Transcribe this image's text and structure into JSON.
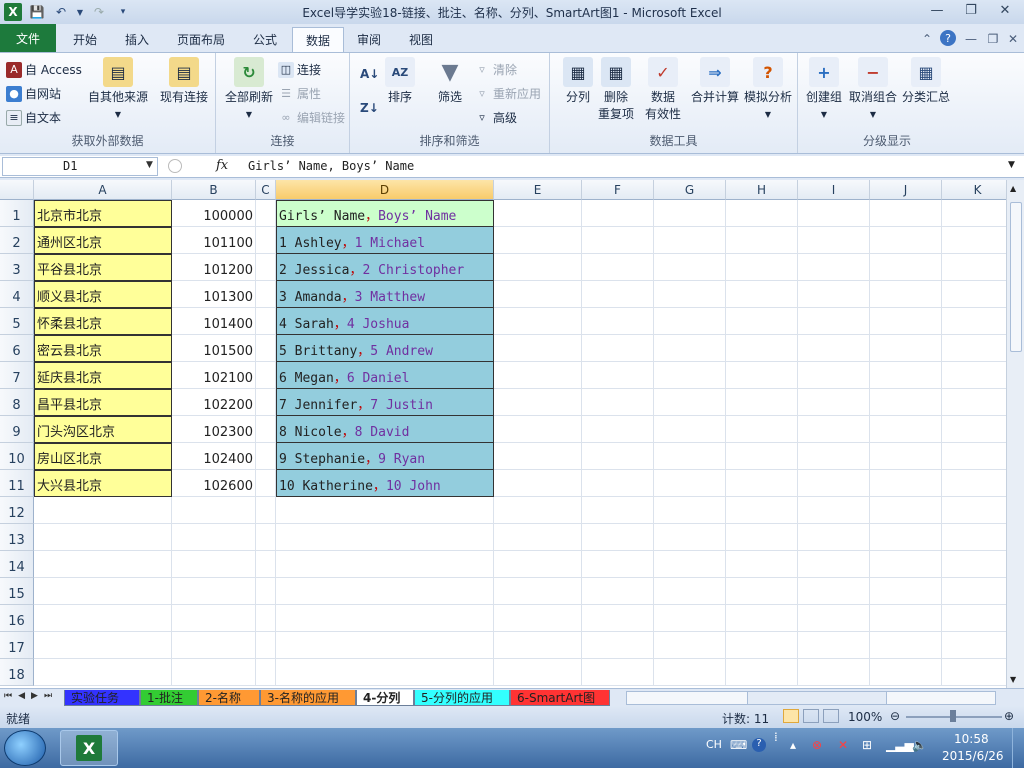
{
  "window": {
    "title": "Excel导学实验18-链接、批注、名称、分列、SmartArt图1 - Microsoft Excel"
  },
  "ribbon_tabs": [
    "文件",
    "开始",
    "插入",
    "页面布局",
    "公式",
    "数据",
    "审阅",
    "视图"
  ],
  "active_tab": "数据",
  "ribbon": {
    "get_external": {
      "label": "获取外部数据",
      "access": "自 Access",
      "web": "自网站",
      "text": "自文本",
      "other": "自其他来源",
      "existing": "现有连接"
    },
    "connections": {
      "label": "连接",
      "refresh_all": "全部刷新",
      "connections": "连接",
      "properties": "属性",
      "edit_links": "编辑链接"
    },
    "sort_filter": {
      "label": "排序和筛选",
      "sort": "排序",
      "filter": "筛选",
      "clear": "清除",
      "reapply": "重新应用",
      "advanced": "高级"
    },
    "data_tools": {
      "label": "数据工具",
      "text_to_columns": "分列",
      "remove_dup_1": "删除",
      "remove_dup_2": "重复项",
      "validation_1": "数据",
      "validation_2": "有效性",
      "consolidate": "合并计算",
      "whatif": "模拟分析"
    },
    "outline": {
      "label": "分级显示",
      "group": "创建组",
      "ungroup": "取消组合",
      "subtotal": "分类汇总"
    }
  },
  "formula_bar": {
    "name_box": "D1",
    "fx": "fx",
    "content": "Girls’ Name, Boys’ Name"
  },
  "columns": [
    "A",
    "B",
    "C",
    "D",
    "E",
    "F",
    "G",
    "H",
    "I",
    "J",
    "K"
  ],
  "rows": [
    "1",
    "2",
    "3",
    "4",
    "5",
    "6",
    "7",
    "8",
    "9",
    "10",
    "11",
    "12",
    "13",
    "14",
    "15",
    "16",
    "17",
    "18"
  ],
  "table": [
    {
      "a": "北京市北京",
      "b": "100000",
      "d1": "Girls’ Name",
      "sep": "，",
      "d2": "Boys’ Name"
    },
    {
      "a": "通州区北京",
      "b": "101100",
      "d1": "1 Ashley",
      "sep": "，",
      "d2": "1 Michael"
    },
    {
      "a": "平谷县北京",
      "b": "101200",
      "d1": "2 Jessica",
      "sep": "，",
      "d2": "2 Christopher"
    },
    {
      "a": "顺义县北京",
      "b": "101300",
      "d1": "3 Amanda",
      "sep": "，",
      "d2": "3 Matthew"
    },
    {
      "a": "怀柔县北京",
      "b": "101400",
      "d1": "4 Sarah",
      "sep": "，",
      "d2": "4 Joshua"
    },
    {
      "a": "密云县北京",
      "b": "101500",
      "d1": "5 Brittany",
      "sep": "，",
      "d2": "5 Andrew"
    },
    {
      "a": "延庆县北京",
      "b": "102100",
      "d1": "6 Megan",
      "sep": "，",
      "d2": "6 Daniel"
    },
    {
      "a": "昌平县北京",
      "b": "102200",
      "d1": "7 Jennifer",
      "sep": "，",
      "d2": "7 Justin"
    },
    {
      "a": "门头沟区北京",
      "b": "102300",
      "d1": "8 Nicole",
      "sep": "，",
      "d2": "8 David"
    },
    {
      "a": "房山区北京",
      "b": "102400",
      "d1": "9 Stephanie",
      "sep": "，",
      "d2": "9 Ryan"
    },
    {
      "a": "大兴县北京",
      "b": "102600",
      "d1": "10 Katherine",
      "sep": "，",
      "d2": "10 John"
    }
  ],
  "sheet_tabs": [
    {
      "label": "实验任务",
      "color": "#3333ff"
    },
    {
      "label": "1-批注",
      "color": "#33cc33"
    },
    {
      "label": "2-名称",
      "color": "#ff9933"
    },
    {
      "label": "3-名称的应用",
      "color": "#ff9933"
    },
    {
      "label": "4-分列",
      "color": "#ffffff"
    },
    {
      "label": "5-分列的应用",
      "color": "#33ffff"
    },
    {
      "label": "6-SmartArt图",
      "color": "#ff3333"
    }
  ],
  "status": {
    "ready": "就绪",
    "count": "计数: 11",
    "zoom": "100%"
  },
  "taskbar": {
    "ime": "CH",
    "time": "10:58",
    "date": "2015/6/26"
  }
}
